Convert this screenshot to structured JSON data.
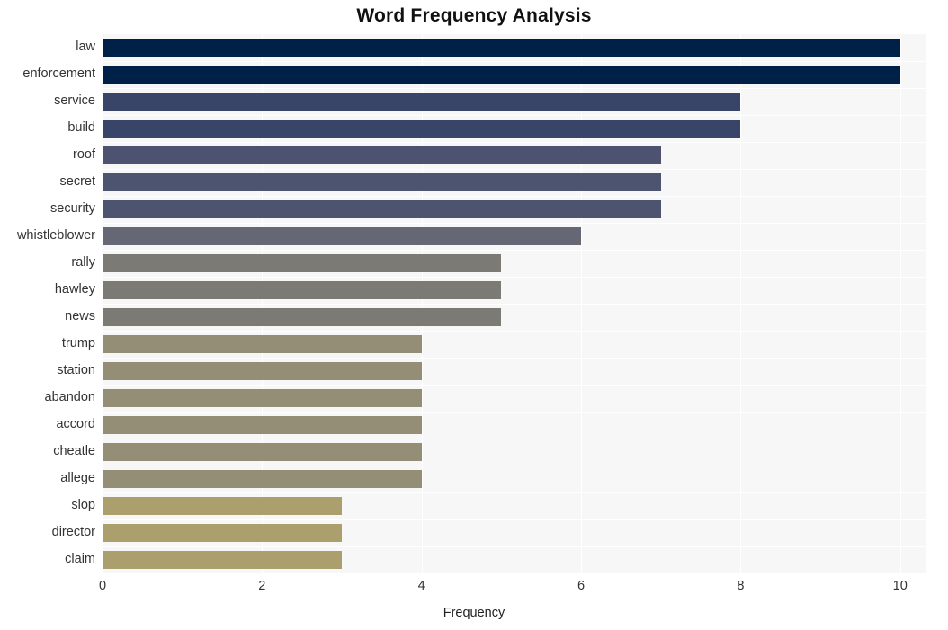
{
  "chart_data": {
    "type": "bar",
    "orientation": "horizontal",
    "title": "Word Frequency Analysis",
    "xlabel": "Frequency",
    "ylabel": "",
    "categories": [
      "law",
      "enforcement",
      "service",
      "build",
      "roof",
      "secret",
      "security",
      "whistleblower",
      "rally",
      "hawley",
      "news",
      "trump",
      "station",
      "abandon",
      "accord",
      "cheatle",
      "allege",
      "slop",
      "director",
      "claim"
    ],
    "values": [
      10,
      10,
      8,
      8,
      7,
      7,
      7,
      6,
      5,
      5,
      5,
      4,
      4,
      4,
      4,
      4,
      4,
      3,
      3,
      3
    ],
    "bar_colors": [
      "#002147",
      "#002147",
      "#384468",
      "#384468",
      "#4c5270",
      "#4d5470",
      "#4d5470",
      "#656874",
      "#7b7a75",
      "#7b7a75",
      "#7b7a75",
      "#948e76",
      "#948e76",
      "#948e76",
      "#948e76",
      "#948e76",
      "#948e76",
      "#ab9f6e",
      "#ab9f6e",
      "#ab9f6e"
    ],
    "xlim": [
      0,
      10.33
    ],
    "xticks": [
      0,
      2,
      4,
      6,
      8,
      10
    ],
    "xtick_labels": [
      "0",
      "2",
      "4",
      "6",
      "8",
      "10"
    ],
    "grid": true,
    "grid_color": "#ffffff",
    "plot_background": "#f7f7f7",
    "figure_background": "#ffffff",
    "legend": null
  }
}
